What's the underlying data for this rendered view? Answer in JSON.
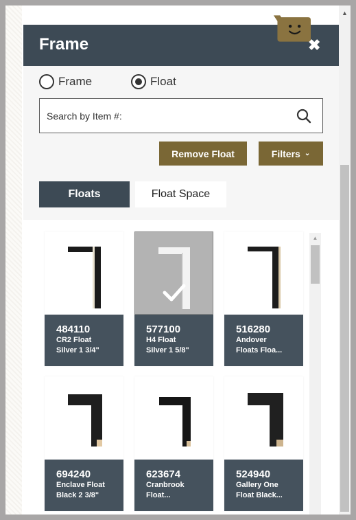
{
  "panel": {
    "title": "Frame",
    "close_icon": "close-icon",
    "radio_options": [
      {
        "label": "Frame",
        "checked": false
      },
      {
        "label": "Float",
        "checked": true
      }
    ],
    "search": {
      "placeholder": "Search by Item #:",
      "value": "",
      "icon": "search-icon"
    },
    "buttons": {
      "remove_float": "Remove Float",
      "filters": "Filters",
      "filters_icon": "chevron-down-icon"
    },
    "tabs": [
      {
        "label": "Floats",
        "active": true
      },
      {
        "label": "Float Space",
        "active": false
      }
    ]
  },
  "items": [
    {
      "number": "484110",
      "name": "CR2 Float\nSilver 1 3/4\"",
      "selected": false,
      "frame_color": "#1a1a1a",
      "edge_color": "#e9e2d0"
    },
    {
      "number": "577100",
      "name": "H4 Float\nSilver 1 5/8\"",
      "selected": true,
      "frame_color": "#f3f3f3",
      "edge_color": "#f3f3f3"
    },
    {
      "number": "516280",
      "name": "Andover\nFloats Floa...",
      "selected": false,
      "frame_color": "#1c1c1c",
      "edge_color": "#d9c7a6"
    },
    {
      "number": "694240",
      "name": "Enclave Float\nBlack 2 3/8\"",
      "selected": false,
      "frame_color": "#1e1e1e",
      "edge_color": "#e2c9a3"
    },
    {
      "number": "623674",
      "name": "Cranbrook\nFloat...",
      "selected": false,
      "frame_color": "#161616",
      "edge_color": "#d8c09a"
    },
    {
      "number": "524940",
      "name": "Gallery One\nFloat Black...",
      "selected": false,
      "frame_color": "#202020",
      "edge_color": "#cdb48e"
    }
  ],
  "colors": {
    "header_bg": "#3d4a55",
    "accent_gold": "#7a6735",
    "caption_bg": "#45525d"
  }
}
